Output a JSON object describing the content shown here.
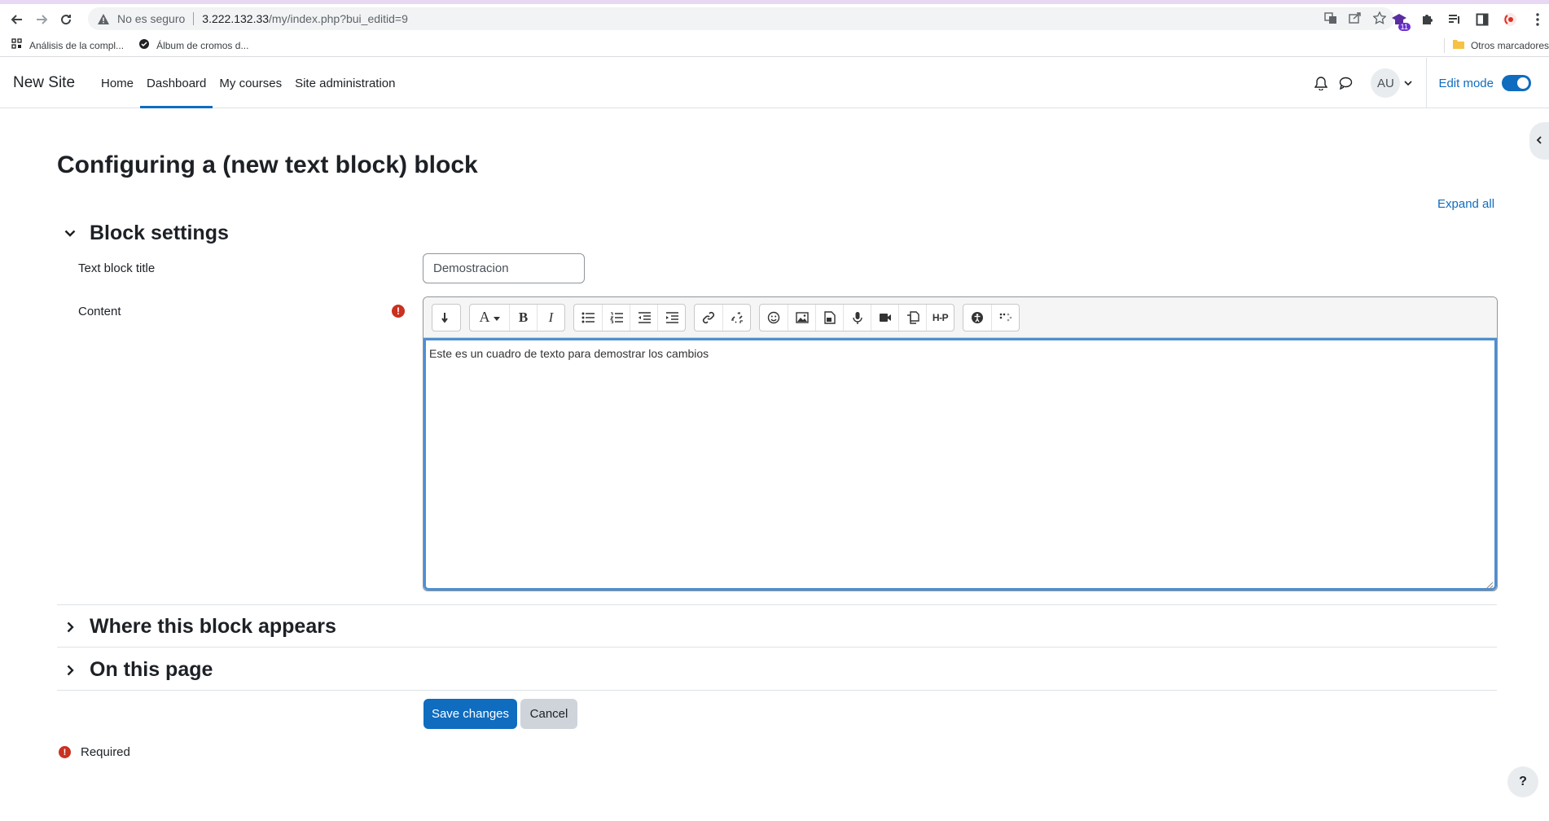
{
  "browser": {
    "security_label": "No es seguro",
    "url_host": "3.222.132.33",
    "url_path": "/my/index.php?bui_editid=9",
    "bookmarks": [
      {
        "label": "Análisis de la compl..."
      },
      {
        "label": "Álbum de cromos d..."
      }
    ],
    "other_bookmarks": "Otros marcadores",
    "extension_badge": "11"
  },
  "navbar": {
    "brand": "New Site",
    "links": [
      {
        "label": "Home"
      },
      {
        "label": "Dashboard",
        "active": true
      },
      {
        "label": "My courses"
      },
      {
        "label": "Site administration"
      }
    ],
    "avatar_initials": "AU",
    "edit_mode_label": "Edit mode",
    "edit_mode_on": true
  },
  "page": {
    "title": "Configuring a (new text block) block",
    "expand_all": "Expand all",
    "sections": {
      "block_settings": "Block settings",
      "where_appears": "Where this block appears",
      "on_this_page": "On this page"
    },
    "fields": {
      "title_label": "Text block title",
      "title_value": "Demostracion",
      "content_label": "Content",
      "content_value": "Este es un cuadro de texto para demostrar los cambios",
      "required_marker": "!"
    },
    "toolbar": {
      "style_button": "A",
      "bold": "B",
      "italic": "I",
      "h5p": "H-P"
    },
    "buttons": {
      "save": "Save changes",
      "cancel": "Cancel"
    },
    "required_note": "Required",
    "help": "?"
  },
  "colors": {
    "primary": "#0f6cbf",
    "danger": "#ca3120",
    "editor_focus": "#4e8fd1"
  }
}
